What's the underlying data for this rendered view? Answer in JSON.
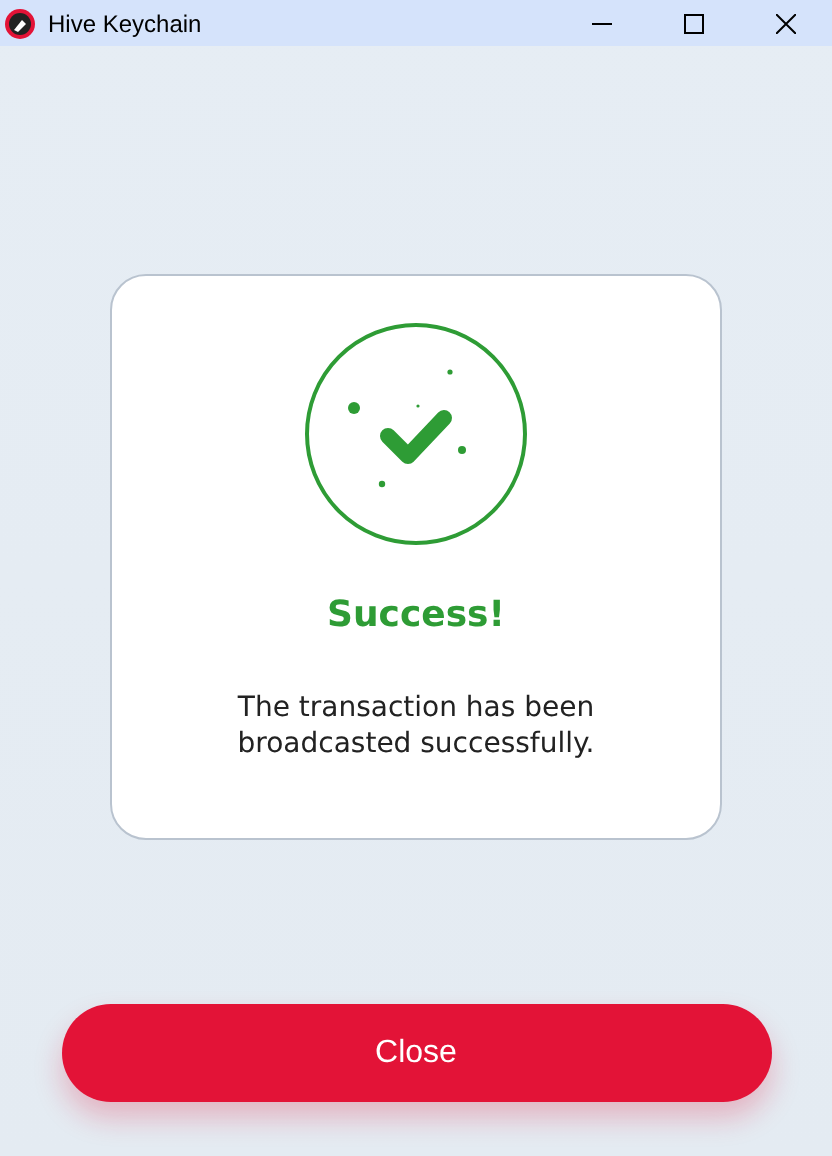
{
  "window": {
    "title": "Hive Keychain"
  },
  "dialog": {
    "title": "Success!",
    "message": "The transaction has been broadcasted successfully."
  },
  "buttons": [
    {
      "label": "Close",
      "kind": "primary"
    }
  ]
}
